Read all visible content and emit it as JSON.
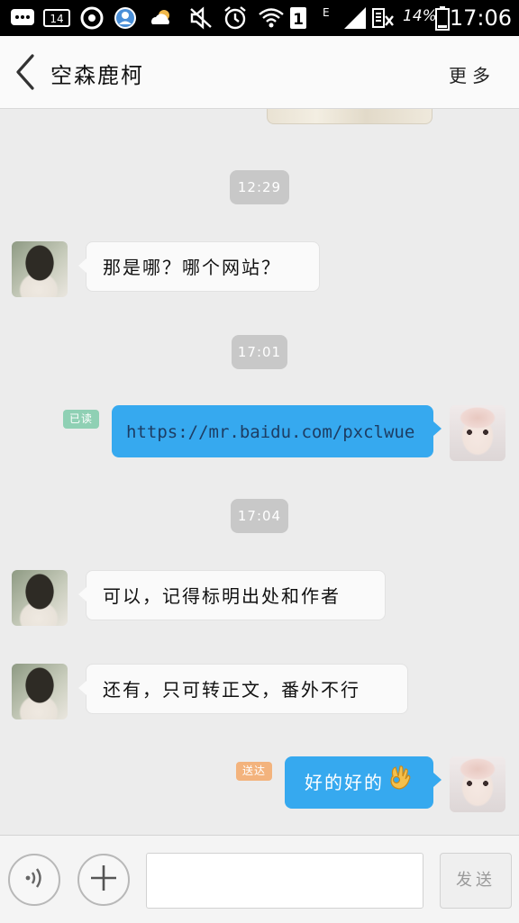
{
  "status_bar": {
    "notification_count": "14",
    "sim_slot": "1",
    "network_type": "E",
    "battery_percent": "14%",
    "time": "17:06",
    "icons": [
      "messages-icon",
      "notification-count-icon",
      "qq-icon",
      "contact-icon",
      "weather-icon",
      "mute-icon",
      "alarm-icon",
      "wifi-icon",
      "sim-icon",
      "signal-icon",
      "data-roaming-icon",
      "battery-icon"
    ]
  },
  "header": {
    "title": "空森鹿柯",
    "more_label": "更多"
  },
  "messages": [
    {
      "type": "time",
      "text": "12:29"
    },
    {
      "type": "incoming",
      "text": "那是哪？哪个网站？"
    },
    {
      "type": "time",
      "text": "17:01"
    },
    {
      "type": "outgoing",
      "status": "已读",
      "text": "https://mr.baidu.com/pxclwue"
    },
    {
      "type": "time",
      "text": "17:04"
    },
    {
      "type": "incoming",
      "text": "可以，记得标明出处和作者"
    },
    {
      "type": "incoming",
      "text": "还有，只可转正文，番外不行"
    },
    {
      "type": "outgoing",
      "status": "送达",
      "text": "好的好的",
      "emoji": "ok-hand-emoji"
    }
  ],
  "input_bar": {
    "voice_icon": "voice-icon",
    "plus_icon": "plus-icon",
    "message_placeholder": "",
    "send_label": "发送"
  },
  "colors": {
    "accent_bubble": "#36a9ef",
    "read_tag": "#8fd0b4",
    "delivered_tag": "#f3b37d",
    "chat_bg": "#ececec"
  }
}
